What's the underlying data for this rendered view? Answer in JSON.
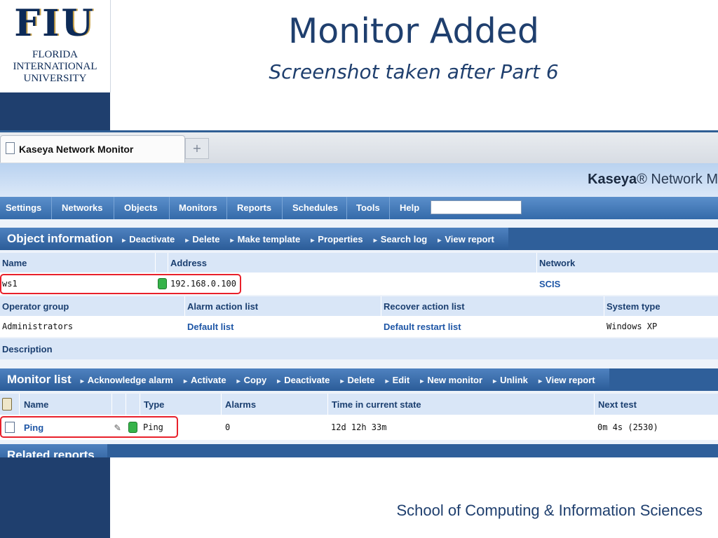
{
  "slide": {
    "logo": {
      "mark": "FIU",
      "line1": "FLORIDA",
      "line2": "INTERNATIONAL",
      "line3": "UNIVERSITY"
    },
    "title": "Monitor Added",
    "subtitle": "Screenshot taken after Part 6",
    "footer": "School of Computing & Information Sciences"
  },
  "browser": {
    "tab_label": "Kaseya Network Monitor",
    "new_tab_glyph": "+"
  },
  "app": {
    "brand_bold": "Kaseya",
    "brand_rest": "® Network M",
    "menu": [
      "Settings",
      "Networks",
      "Objects",
      "Monitors",
      "Reports",
      "Schedules",
      "Tools",
      "Help"
    ]
  },
  "object_info": {
    "title": "Object information",
    "actions": [
      "Deactivate",
      "Delete",
      "Make template",
      "Properties",
      "Search log",
      "View report"
    ],
    "headers1": {
      "name": "Name",
      "address": "Address",
      "network": "Network"
    },
    "values1": {
      "name": "ws1",
      "address": "192.168.0.100",
      "network": "SCIS"
    },
    "headers2": {
      "operator_group": "Operator group",
      "alarm_action_list": "Alarm action list",
      "recover_action_list": "Recover action list",
      "system_type": "System type"
    },
    "values2": {
      "operator_group": "Administrators",
      "alarm_action_list": "Default list",
      "recover_action_list": "Default restart list",
      "system_type": "Windows XP"
    },
    "description_label": "Description"
  },
  "monitor_list": {
    "title": "Monitor list",
    "actions": [
      "Acknowledge alarm",
      "Activate",
      "Copy",
      "Deactivate",
      "Delete",
      "Edit",
      "New monitor",
      "Unlink",
      "View report"
    ],
    "headers": {
      "name": "Name",
      "type": "Type",
      "alarms": "Alarms",
      "time": "Time in current state",
      "next_test": "Next test"
    },
    "row": {
      "name": "Ping",
      "type": "Ping",
      "alarms": "0",
      "time": "12d 12h 33m",
      "next_test": "0m 4s (2530)"
    }
  },
  "related_reports": {
    "title": "Related reports"
  },
  "colors": {
    "accent": "#2f5f9a",
    "status_ok": "#36b34a",
    "highlight": "#e8202b"
  }
}
